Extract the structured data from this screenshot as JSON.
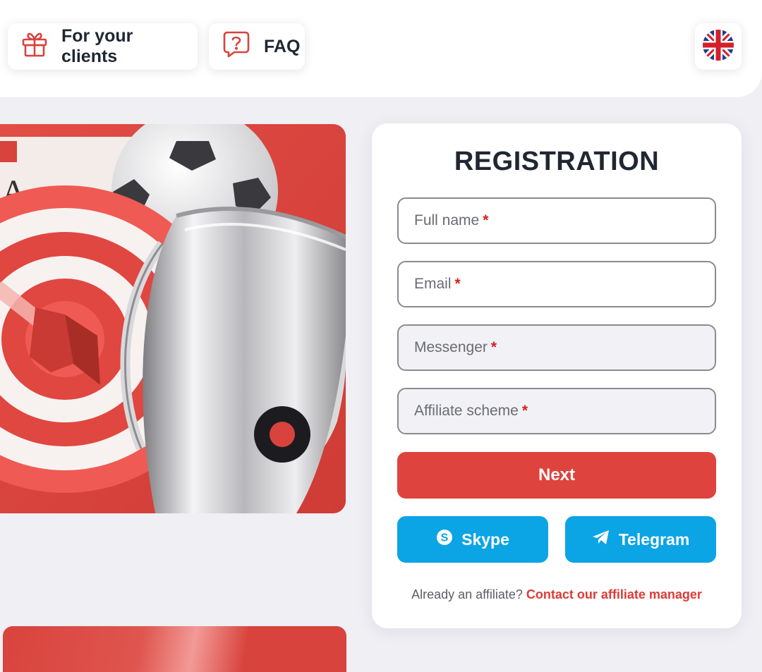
{
  "header": {
    "nav": [
      {
        "label": "For your clients",
        "icon": "gift-icon"
      },
      {
        "label": "FAQ",
        "icon": "question-bubble-icon"
      }
    ],
    "language_icon": "uk-flag-icon"
  },
  "hero": {
    "icon": "target-trophy-illustration",
    "card_letter": "A"
  },
  "registration": {
    "title": "REGISTRATION",
    "fields": [
      {
        "placeholder": "Full name",
        "required_mark": "*"
      },
      {
        "placeholder": "Email",
        "required_mark": "*"
      },
      {
        "placeholder": "Messenger",
        "required_mark": "*"
      },
      {
        "placeholder": "Affiliate scheme",
        "required_mark": "*"
      }
    ],
    "next_label": "Next",
    "skype_label": "Skype",
    "telegram_label": "Telegram",
    "footer_prefix": "Already an affiliate?",
    "footer_link": "Contact our affiliate manager"
  },
  "colors": {
    "accent_red": "#de433d",
    "messenger_blue": "#0ba4e4",
    "page_bg": "#efeff4"
  }
}
